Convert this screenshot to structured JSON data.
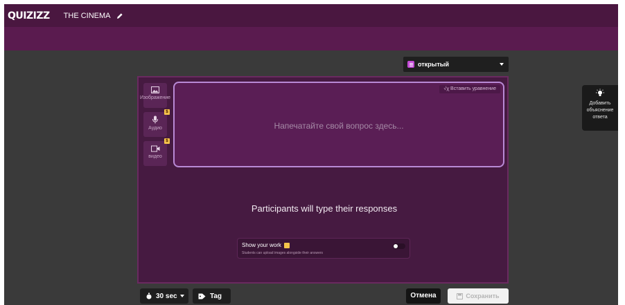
{
  "app": {
    "logo": "QUIZIZZ",
    "title": "THE CINEMA"
  },
  "question_type": {
    "selected": "открытый"
  },
  "question": {
    "placeholder": "Напечатайте свой вопрос здесь...",
    "equation_button": "√ꭓ Вставить уравнение"
  },
  "media": {
    "image_label": "Изображение",
    "audio_label": "Аудио",
    "video_label": "видео"
  },
  "response": {
    "participants_text": "Participants will type their responses"
  },
  "show_work": {
    "title": "Show your work",
    "subtitle": "Students can upload images alongside their answers",
    "enabled": false
  },
  "bottom": {
    "time_label": "30 sec",
    "tag_label": "Tag",
    "cancel_label": "Отмена",
    "save_label": "Сохранить"
  },
  "explanation": {
    "label": "Добавить объяснение ответа"
  },
  "colors": {
    "brand_purple": "#4a1740",
    "editor_bg": "#461a41",
    "pro_badge": "#f5c44a"
  },
  "icons": [
    "pencil-icon",
    "image-icon",
    "microphone-icon",
    "video-camera-icon",
    "stopwatch-icon",
    "tag-icon",
    "save-icon",
    "lightbulb-icon"
  ]
}
